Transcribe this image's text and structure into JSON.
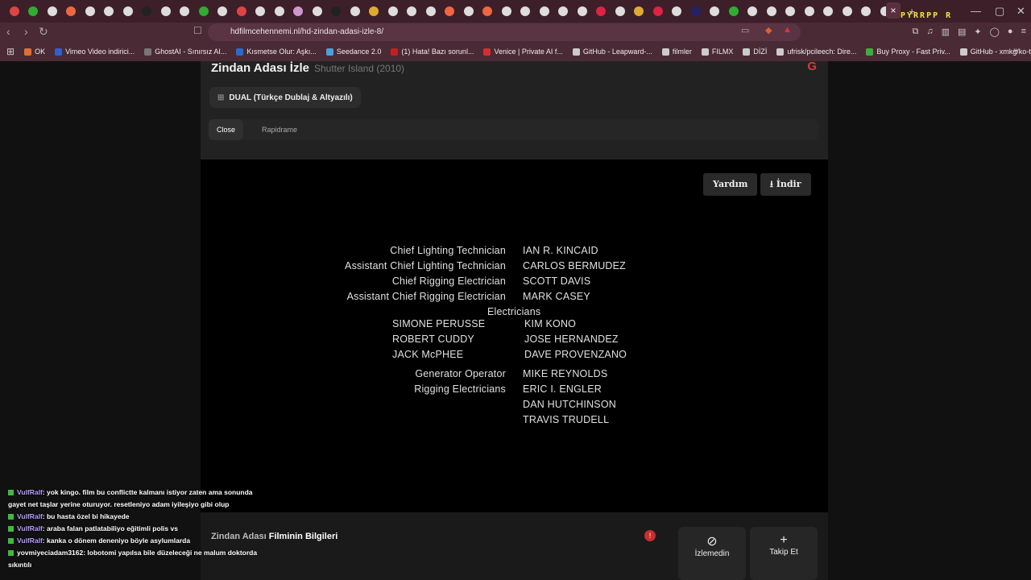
{
  "browser": {
    "tab_count_visible": 47,
    "marquee": "PYRRPP R",
    "active_tab_close": "×",
    "new_tab": "+",
    "url": "hdfilmcehennemi.nl/hd-zindan-adasi-izle-8/",
    "bookmarks": [
      "OK",
      "Vimeo Video indirici...",
      "GhostAI - Sınırsız AI...",
      "Kısmetse Olur: Aşkı...",
      "Seedance 2.0",
      "(1) Hata! Bazı sorunl...",
      "Venice | Private AI f...",
      "GitHub - Leapward-...",
      "filmler",
      "FILMX",
      "DİZİ",
      "ufrisk/pcileech: Dire...",
      "Buy Proxy - Fast Priv...",
      "GitHub - xmkg/ko-t..."
    ]
  },
  "page": {
    "title": "Zindan Adası İzle",
    "subtitle": "Shutter Island (2010)",
    "dual_label": "DUAL (Türkçe Dublaj & Altyazılı)",
    "sources": [
      "Close",
      "Rapidrame"
    ],
    "help_button": "Yardım",
    "download_button": "İndir"
  },
  "credits": {
    "roles1": [
      "Chief Lighting Technician",
      "Assistant Chief Lighting Technician",
      "Chief Rigging Electrician",
      "Assistant Chief Rigging Electrician"
    ],
    "names1": [
      "IAN R. KINCAID",
      "CARLOS BERMUDEZ",
      "SCOTT DAVIS",
      "MARK CASEY"
    ],
    "group": "Electricians",
    "group_left": [
      "SIMONE PERUSSE",
      "ROBERT CUDDY",
      "JACK McPHEE"
    ],
    "group_right": [
      "KIM KONO",
      "JOSE HERNANDEZ",
      "DAVE PROVENZANO"
    ],
    "roles2": [
      "Generator Operator",
      "Rigging Electricians"
    ],
    "names2": [
      "MIKE REYNOLDS",
      "ERIC I. ENGLER",
      "DAN HUTCHINSON",
      "TRAVIS TRUDELL"
    ]
  },
  "info": {
    "title_part": "Zindan Adası",
    "title_rest": "Filminin Bilgileri",
    "alert": "!",
    "watched_label": "İzlemedin",
    "follow_label": "Takip Et"
  },
  "chat": [
    {
      "user": "VulfRalf",
      "text": ": yok kingo. film bu conflictte kalmanı istiyor zaten ama sonunda gayet net taşlar yerine oturuyor. resetleniyo adam iyileşiyo gibi olup"
    },
    {
      "user": "VulfRalf",
      "text": ": bu hasta özel bi hikayede"
    },
    {
      "user": "VulfRalf",
      "text": ": araba falan patlatabiliyo eğitimli polis vs"
    },
    {
      "user": "VulfRalf",
      "text": ": kanka o dönem deneniyo böyle asylumlarda"
    },
    {
      "user": "yovmiyeciadam3162",
      "text": ": lobotomi yapılsa bile düzeleceği ne malum doktorda sıkıntılı"
    }
  ]
}
